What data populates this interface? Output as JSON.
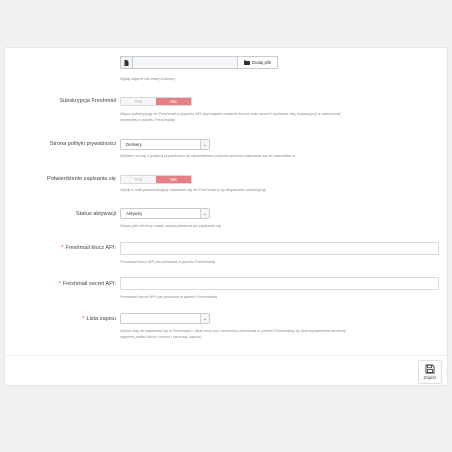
{
  "file_upload": {
    "button_label": "Dodaj plik",
    "help": "Wgraj zdjęcie dla lewej kolumny"
  },
  "subscription": {
    "label": "Subskrypcja Freshmail",
    "yes": "TAK",
    "no": "NIE",
    "selected": "NIE",
    "help_line1": "Włącz subskrypcję do Freshmail-a poprzez API (wymagane podanie klucza oraz secret i wybranie listy subskrypcji w utworzonej",
    "help_line2": "wcześniej w panelu Freshmaila)"
  },
  "privacy": {
    "label": "Strona polityki prywatności",
    "value": "Delivery",
    "help": "Wybierz stronę z polityką prywatności do wyświetlenia podczas procesu zapisania się do newsletter-a"
  },
  "confirm": {
    "label": "Potwierdzenie zapisania się",
    "yes": "TAK",
    "no": "NIE",
    "selected": "NIE",
    "help": "Wyślij e-mail potwierdzający zapisanie się do Freshmail-a by aktywować subskrypcję"
  },
  "status": {
    "label": "Status aktywacji",
    "value": "Aktywny",
    "help": "Status jaki chcemy nadać subskrybentowi po zapisaniu się"
  },
  "api_key": {
    "label": "Freshmail klucz API",
    "value": "",
    "help": "Freshmail klucz API (do pobrania w panelu Freshmaila)"
  },
  "api_secret": {
    "label": "Freshmail secret API",
    "value": "",
    "help": "Freshmail secret API (do pobrania w panelu Freshmaila)"
  },
  "list": {
    "label": "Lista zapisu",
    "value": "",
    "help_line1": "Wybór listy do zapisania się w Freshmail-u (lista musi być wcześniej utworzona w panelu Freshmaila) by była wyświetlona możemy",
    "help_line2": "najpierw podać klucz i secret i nacisnąć zapisz)"
  },
  "required_marker": "*",
  "label_suffix": ":",
  "save_button": "Zapisz",
  "icons": {
    "file": "file-icon",
    "folder": "folder-icon",
    "save": "floppy-disk-icon",
    "select_arrow": "chevron-down-icon"
  },
  "colors": {
    "toggle_active": "#e87d84",
    "required": "#ee3322"
  }
}
